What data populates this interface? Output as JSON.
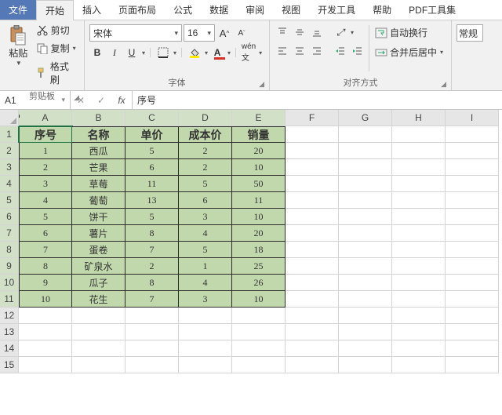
{
  "menubar": {
    "file": "文件",
    "tabs": [
      "开始",
      "插入",
      "页面布局",
      "公式",
      "数据",
      "审阅",
      "视图",
      "开发工具",
      "帮助",
      "PDF工具集"
    ],
    "active_index": 0
  },
  "ribbon": {
    "clipboard": {
      "label": "剪贴板",
      "paste": "粘贴",
      "cut": "剪切",
      "copy": "复制",
      "format_painter": "格式刷"
    },
    "font": {
      "label": "字体",
      "family": "宋体",
      "size": "16",
      "bold": "B",
      "italic": "I",
      "underline": "U"
    },
    "alignment": {
      "label": "对齐方式",
      "wrap": "自动换行",
      "merge": "合并后居中"
    },
    "number": {
      "label": "常规"
    }
  },
  "namebox": "A1",
  "formula": "序号",
  "columns": [
    "A",
    "B",
    "C",
    "D",
    "E",
    "F",
    "G",
    "H",
    "I"
  ],
  "row_count": 15,
  "table": {
    "headers": [
      "序号",
      "名称",
      "单价",
      "成本价",
      "销量"
    ],
    "rows": [
      [
        "1",
        "西瓜",
        "5",
        "2",
        "20"
      ],
      [
        "2",
        "芒果",
        "6",
        "2",
        "10"
      ],
      [
        "3",
        "草莓",
        "11",
        "5",
        "50"
      ],
      [
        "4",
        "葡萄",
        "13",
        "6",
        "11"
      ],
      [
        "5",
        "饼干",
        "5",
        "3",
        "10"
      ],
      [
        "6",
        "薯片",
        "8",
        "4",
        "20"
      ],
      [
        "7",
        "蛋卷",
        "7",
        "5",
        "18"
      ],
      [
        "8",
        "矿泉水",
        "2",
        "1",
        "25"
      ],
      [
        "9",
        "瓜子",
        "8",
        "4",
        "26"
      ],
      [
        "10",
        "花生",
        "7",
        "3",
        "10"
      ]
    ]
  },
  "selected_cell": {
    "row": 1,
    "col": "A"
  }
}
